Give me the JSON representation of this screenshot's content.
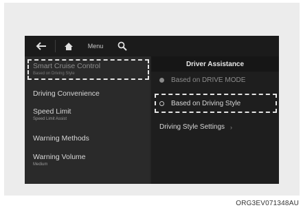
{
  "topbar": {
    "back_icon": "back-arrow-icon",
    "home_icon": "home-icon",
    "menu_label": "Menu",
    "search_icon": "search-icon"
  },
  "left_menu": {
    "items": [
      {
        "label": "Smart Cruise Control",
        "sublabel": "Based on Driving Style"
      },
      {
        "label": "Driving Convenience",
        "sublabel": ""
      },
      {
        "label": "Speed Limit",
        "sublabel": "Speed Limit Assist"
      },
      {
        "label": "Warning Methods",
        "sublabel": ""
      },
      {
        "label": "Warning Volume",
        "sublabel": "Medium"
      }
    ]
  },
  "right_panel": {
    "header": "Driver Assistance",
    "options": [
      {
        "label": "Based on DRIVE MODE",
        "selected": true
      },
      {
        "label": "Based on Driving Style",
        "selected": false
      },
      {
        "label": "Driving Style Settings",
        "type": "link"
      }
    ],
    "chevron": "›"
  },
  "caption": "ORG3EV071348AU"
}
